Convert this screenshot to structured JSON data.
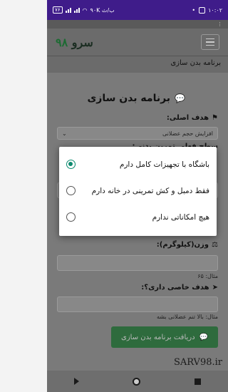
{
  "status_bar": {
    "time": "۱۰:۰۲",
    "network_speed": "۹۰K ب/ث",
    "battery": "۷۶"
  },
  "nav": {
    "brand_text": "سرو",
    "brand_num": "۹۸"
  },
  "subtitle": "برنامه بدن سازی",
  "card": {
    "title": "برنامه بدن سازی",
    "goal_label": "هدف اصلی:",
    "goal_value": "افزایش حجم عضلانی",
    "level_label": "سطح فعلی تمرین بدنی:",
    "weight_label": "وزن(کیلوگرم):",
    "weight_hint": "مثال: ۶۵",
    "special_goal_label": "هدف خاصی داری؟:",
    "special_goal_hint": "مثال: بالا تنم عضلانی بشه",
    "submit_label": "دریافت برنامه بدن سازی"
  },
  "dialog": {
    "options": [
      {
        "label": "باشگاه با تجهیزات کامل دارم",
        "checked": true
      },
      {
        "label": "فقط دمبل و کش تمرینی در خانه دارم",
        "checked": false
      },
      {
        "label": "هیچ امکاناتی ندارم",
        "checked": false
      }
    ]
  },
  "watermark": "SARV98.ir",
  "colors": {
    "status_bar": "#3f1c8a",
    "accent_radio": "#0d8a6f",
    "button_green": "#2e6b3d",
    "brand_green": "#1d6b33"
  }
}
